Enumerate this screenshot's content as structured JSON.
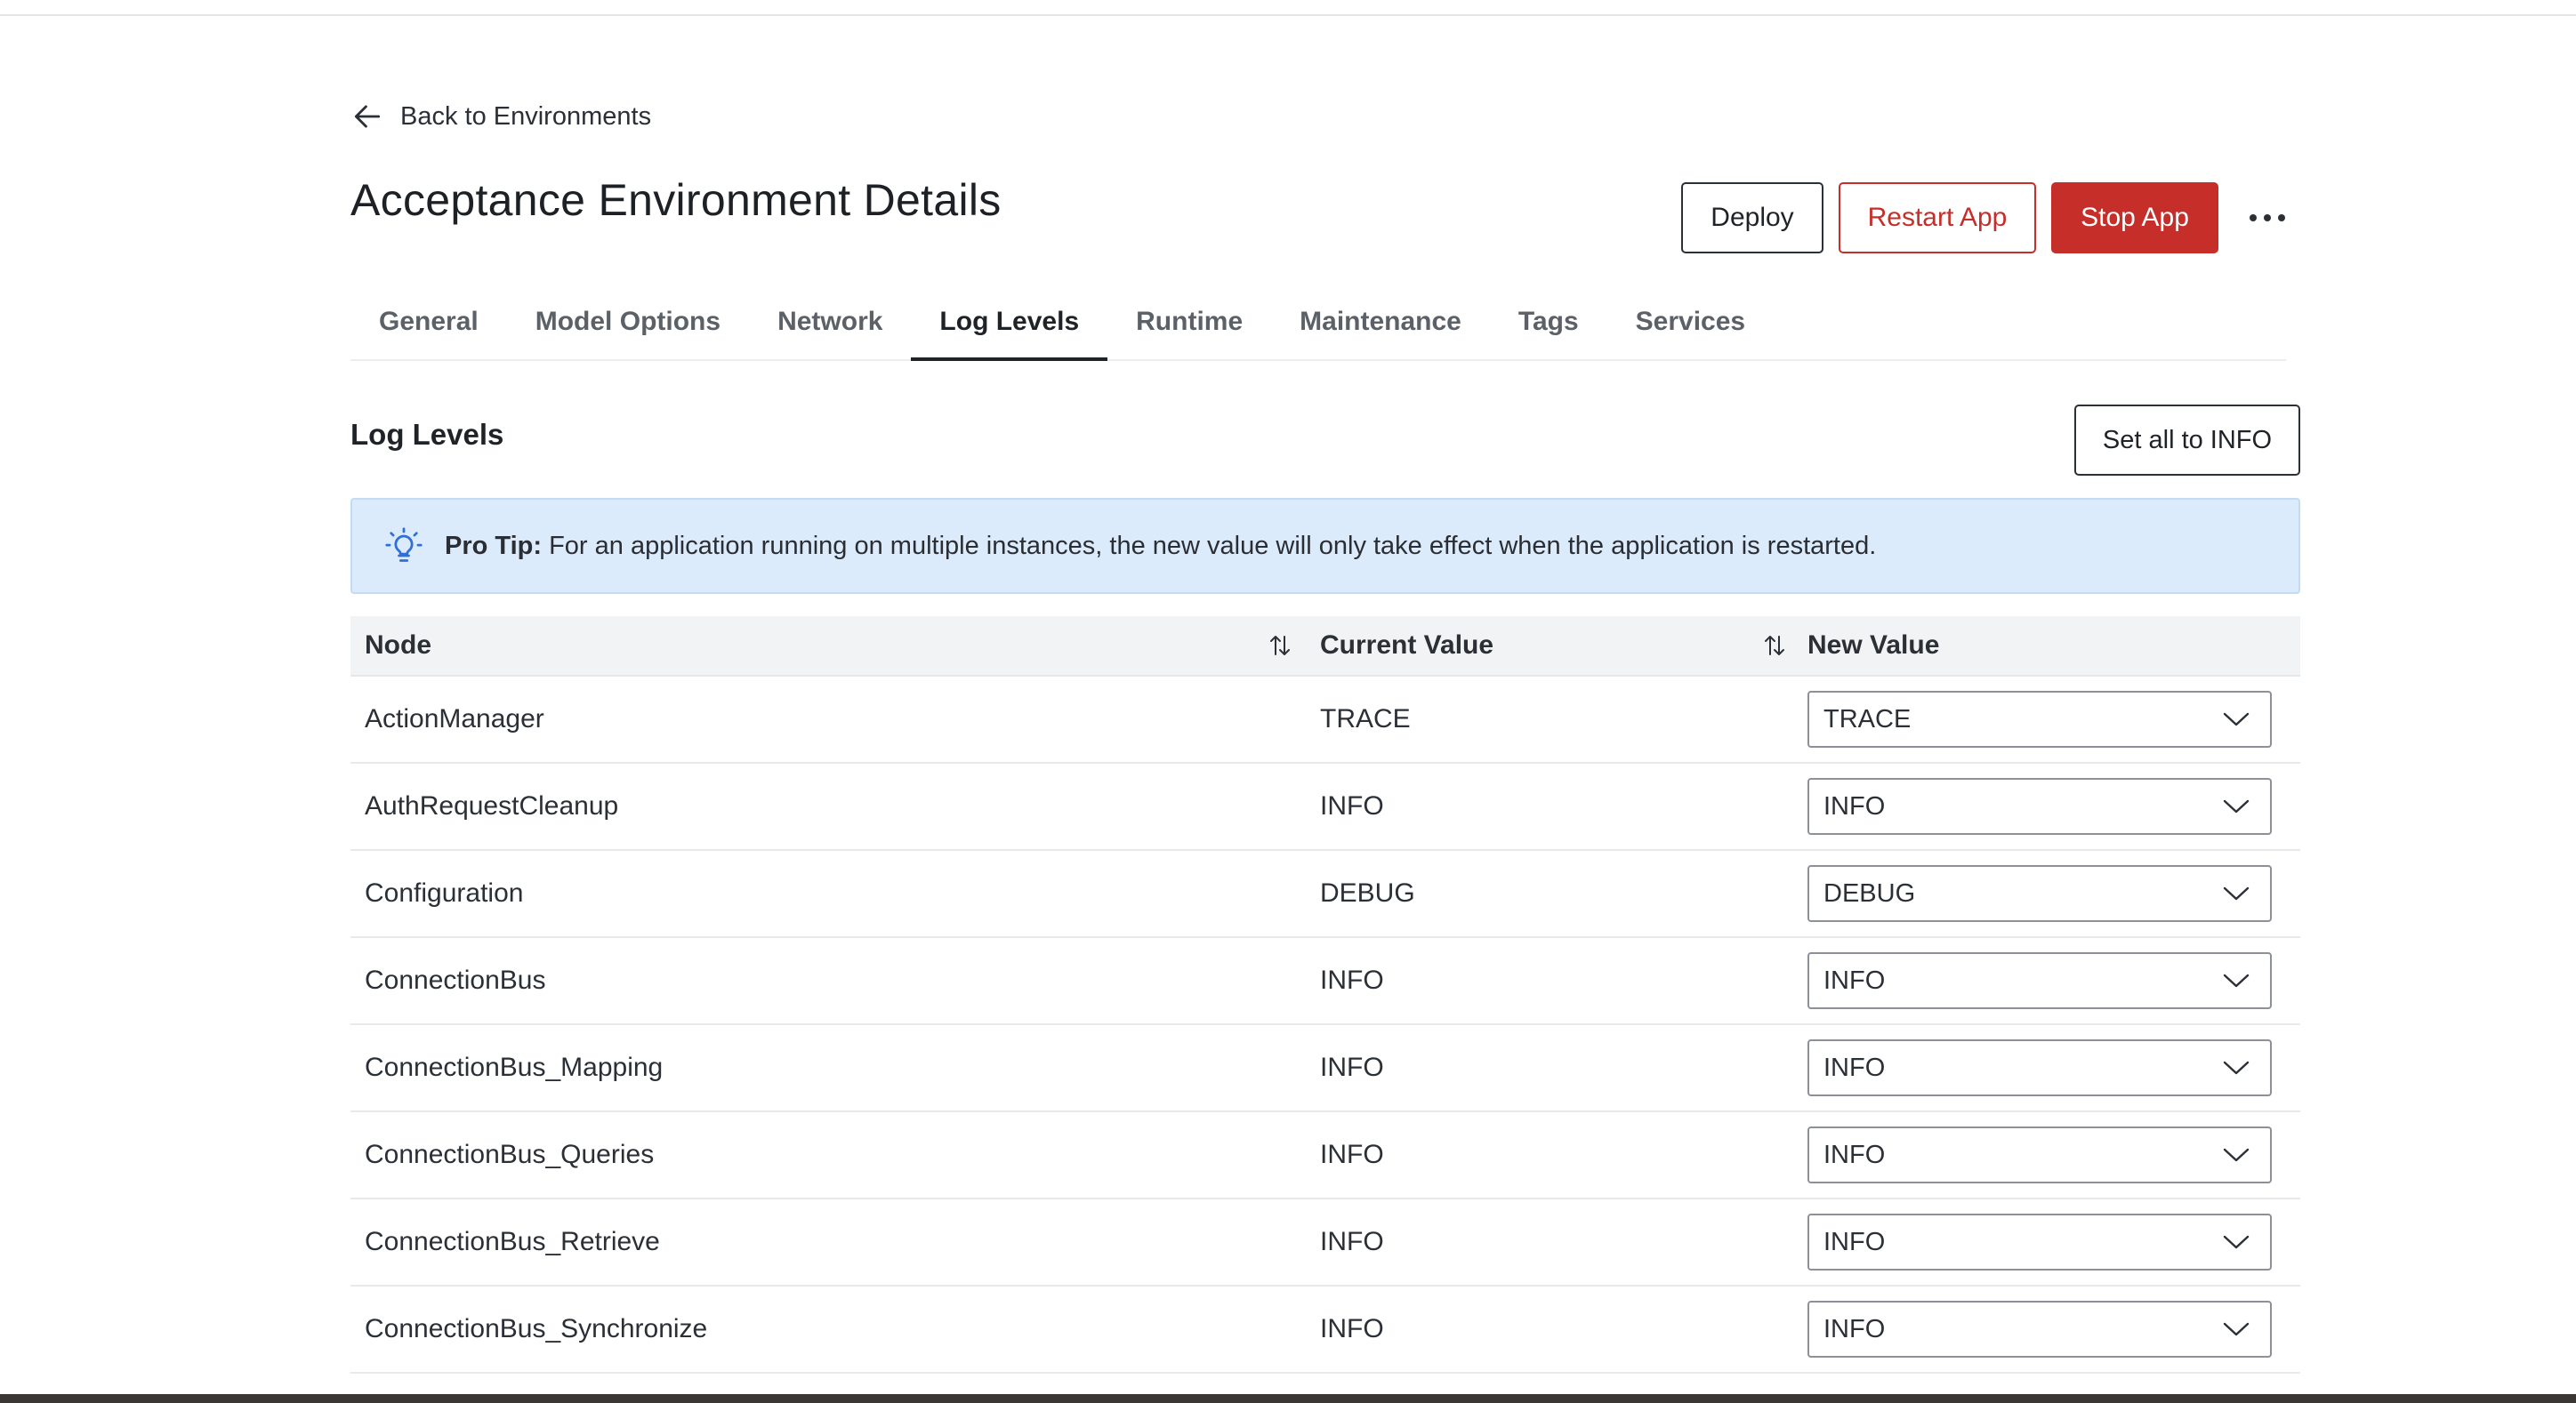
{
  "back_link": {
    "label": "Back to Environments",
    "icon": "arrow-left-icon"
  },
  "page_title": "Acceptance Environment Details",
  "actions": {
    "deploy": "Deploy",
    "restart": "Restart App",
    "stop": "Stop App",
    "more_icon": "more-horizontal-icon"
  },
  "tabs": [
    {
      "label": "General",
      "active": false
    },
    {
      "label": "Model Options",
      "active": false
    },
    {
      "label": "Network",
      "active": false
    },
    {
      "label": "Log Levels",
      "active": true
    },
    {
      "label": "Runtime",
      "active": false
    },
    {
      "label": "Maintenance",
      "active": false
    },
    {
      "label": "Tags",
      "active": false
    },
    {
      "label": "Services",
      "active": false
    }
  ],
  "section": {
    "title": "Log Levels",
    "set_all_button": "Set all to INFO"
  },
  "tip": {
    "icon": "lightbulb-icon",
    "label": "Pro Tip:",
    "text": " For an application running on multiple instances, the new value will only take effect when the application is restarted."
  },
  "table": {
    "headers": {
      "node": "Node",
      "current": "Current Value",
      "new": "New Value"
    },
    "rows": [
      {
        "node": "ActionManager",
        "current": "TRACE",
        "new": "TRACE"
      },
      {
        "node": "AuthRequestCleanup",
        "current": "INFO",
        "new": "INFO"
      },
      {
        "node": "Configuration",
        "current": "DEBUG",
        "new": "DEBUG"
      },
      {
        "node": "ConnectionBus",
        "current": "INFO",
        "new": "INFO"
      },
      {
        "node": "ConnectionBus_Mapping",
        "current": "INFO",
        "new": "INFO"
      },
      {
        "node": "ConnectionBus_Queries",
        "current": "INFO",
        "new": "INFO"
      },
      {
        "node": "ConnectionBus_Retrieve",
        "current": "INFO",
        "new": "INFO"
      },
      {
        "node": "ConnectionBus_Synchronize",
        "current": "INFO",
        "new": "INFO"
      }
    ]
  },
  "colors": {
    "danger": "#c62e2a",
    "tip_background": "#dcebfb",
    "tip_icon": "#2f6fd6",
    "table_header_bg": "#f2f3f4"
  }
}
